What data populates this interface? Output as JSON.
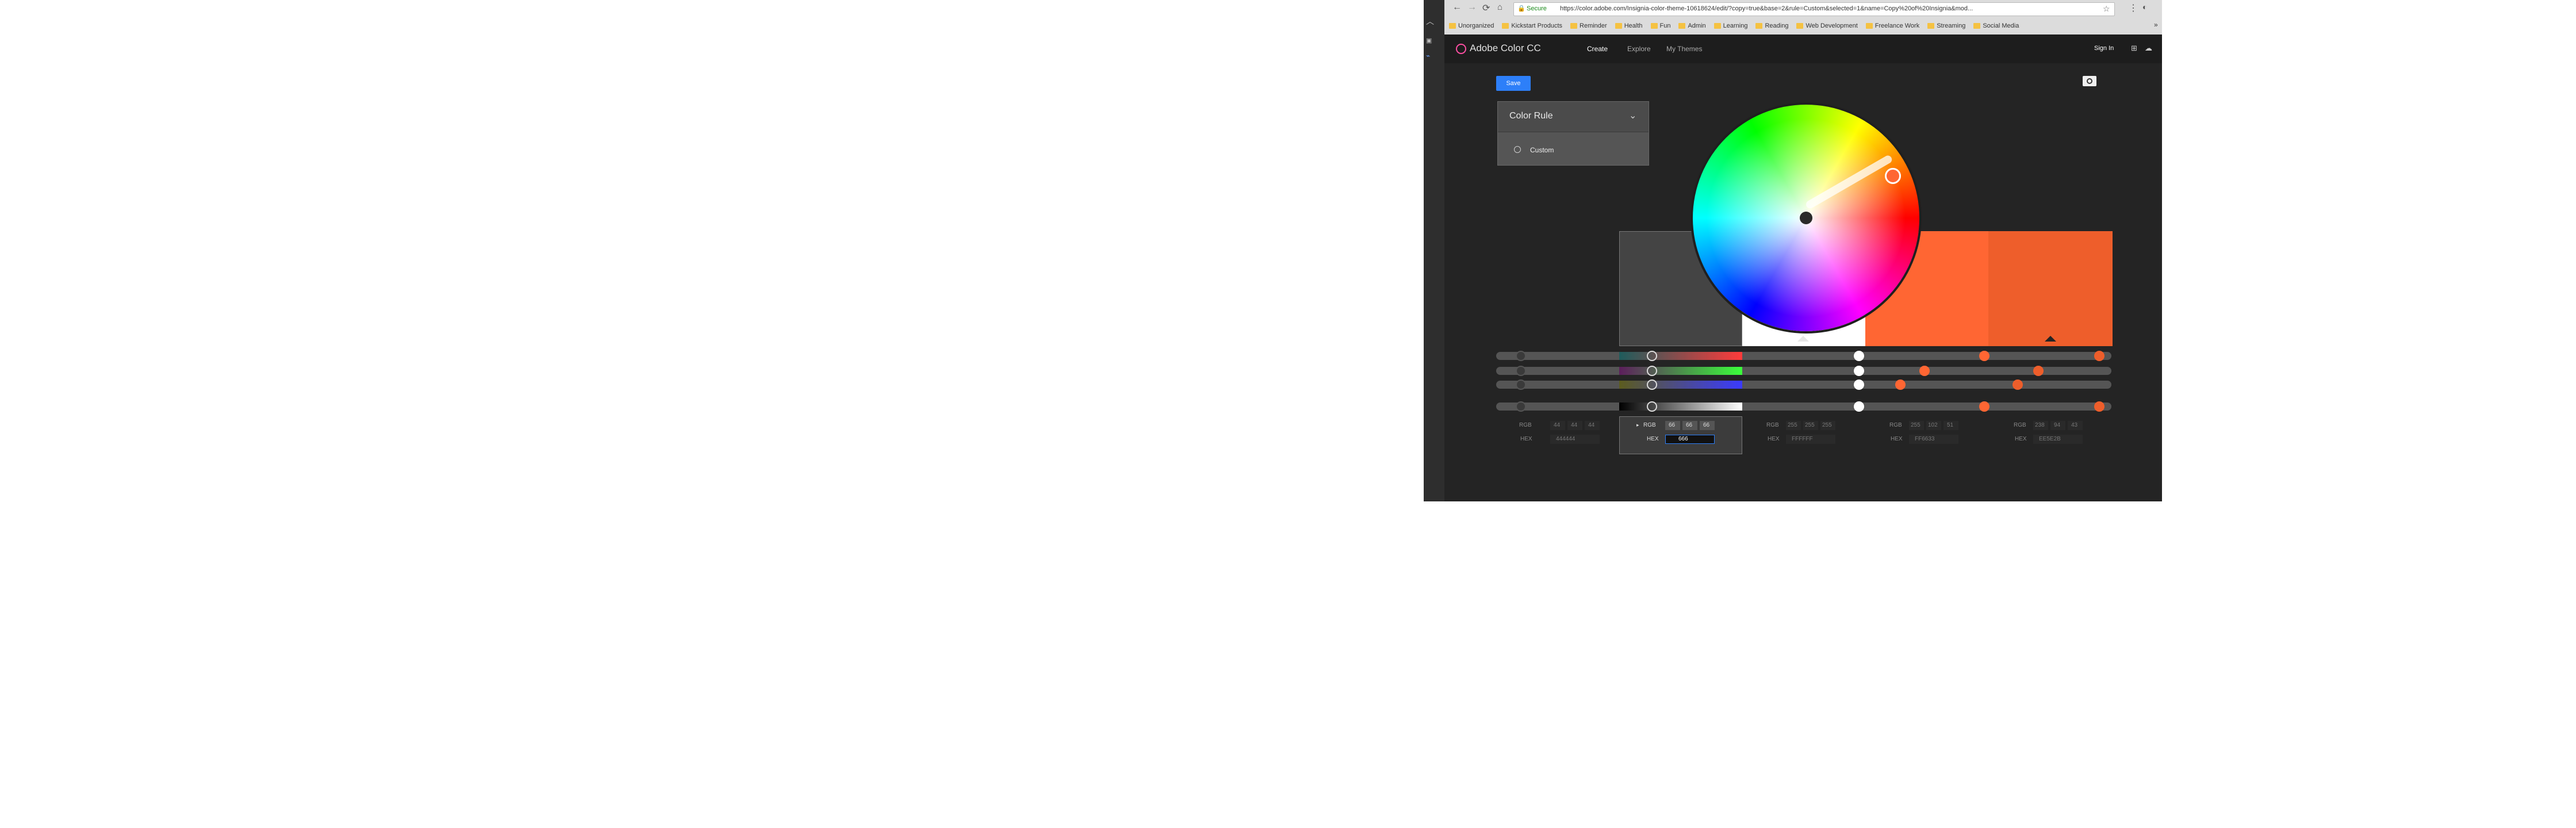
{
  "browser": {
    "nav_buttons": [
      "back-icon",
      "forward-icon",
      "reload-icon",
      "home-icon"
    ],
    "address": {
      "secure_label": "Secure",
      "url": "https://color.adobe.com/Insignia-color-theme-10618624/edit/?copy=true&base=2&rule=Custom&selected=1&name=Copy%20of%20Insignia&mod..."
    },
    "bookmarks": [
      "Unorganized",
      "Kickstart Products",
      "Reminder",
      "Health",
      "Fun",
      "Admin",
      "Learning",
      "Reading",
      "Web Development",
      "Freelance Work",
      "Streaming",
      "Social Media"
    ],
    "overflow": "»"
  },
  "app": {
    "logo_text": "Adobe Color CC",
    "nav": [
      "Create",
      "Explore",
      "My Themes"
    ],
    "sign_in": "Sign In",
    "save_label": "Save",
    "color_rule": {
      "title": "Color Rule",
      "selected": "Custom"
    }
  },
  "swatches": [
    {
      "color": "#444444",
      "mode": "RGB",
      "rgb": [
        "44",
        "44",
        "44"
      ],
      "hex": "444444"
    },
    {
      "color": "#666666",
      "mode": "RGB",
      "rgb": [
        "66",
        "66",
        "66"
      ],
      "hex": "666"
    },
    {
      "color": "#FFFFFF",
      "mode": "RGB",
      "rgb": [
        "255",
        "255",
        "255"
      ],
      "hex": "FFFFFF"
    },
    {
      "color": "#FF6633",
      "mode": "RGB",
      "rgb": [
        "255",
        "102",
        "51"
      ],
      "hex": "FF6633"
    },
    {
      "color": "#EE5E2B",
      "mode": "RGB",
      "rgb": [
        "238",
        "94",
        "43"
      ],
      "hex": "EE5E2B"
    }
  ],
  "labels": {
    "rgb": "RGB",
    "hex": "HEX"
  },
  "colors": {
    "page_bg": "#242424",
    "chrome_bg": "#dcdcdc",
    "accent_blue": "#2d7ff9",
    "orange": "#ff6633",
    "orange_dark": "#ee5e2b",
    "gray_swatch": "#444444"
  }
}
